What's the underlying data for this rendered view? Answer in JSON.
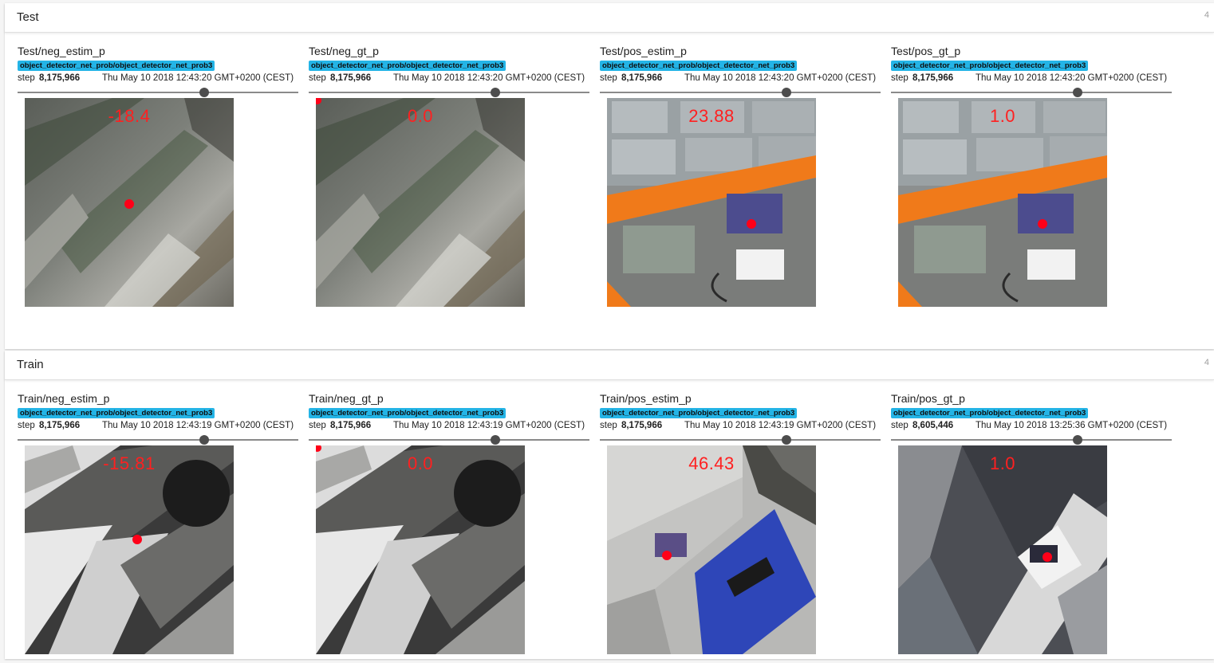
{
  "sections": [
    {
      "title": "Test",
      "count": "4",
      "cards": [
        {
          "title": "Test/neg_estim_p",
          "tag": "object_detector_net_prob/object_detector_net_prob3",
          "step_label": "step",
          "step": "8,175,966",
          "time": "Thu May 10 2018 12:43:20 GMT+0200 (CEST)",
          "value_text": "-18.4"
        },
        {
          "title": "Test/neg_gt_p",
          "tag": "object_detector_net_prob/object_detector_net_prob3",
          "step_label": "step",
          "step": "8,175,966",
          "time": "Thu May 10 2018 12:43:20 GMT+0200 (CEST)",
          "value_text": "0.0"
        },
        {
          "title": "Test/pos_estim_p",
          "tag": "object_detector_net_prob/object_detector_net_prob3",
          "step_label": "step",
          "step": "8,175,966",
          "time": "Thu May 10 2018 12:43:20 GMT+0200 (CEST)",
          "value_text": "23.88"
        },
        {
          "title": "Test/pos_gt_p",
          "tag": "object_detector_net_prob/object_detector_net_prob3",
          "step_label": "step",
          "step": "8,175,966",
          "time": "Thu May 10 2018 12:43:20 GMT+0200 (CEST)",
          "value_text": "1.0"
        }
      ]
    },
    {
      "title": "Train",
      "count": "4",
      "cards": [
        {
          "title": "Train/neg_estim_p",
          "tag": "object_detector_net_prob/object_detector_net_prob3",
          "step_label": "step",
          "step": "8,175,966",
          "time": "Thu May 10 2018 12:43:19 GMT+0200 (CEST)",
          "value_text": "-15.81"
        },
        {
          "title": "Train/neg_gt_p",
          "tag": "object_detector_net_prob/object_detector_net_prob3",
          "step_label": "step",
          "step": "8,175,966",
          "time": "Thu May 10 2018 12:43:19 GMT+0200 (CEST)",
          "value_text": "0.0"
        },
        {
          "title": "Train/pos_estim_p",
          "tag": "object_detector_net_prob/object_detector_net_prob3",
          "step_label": "step",
          "step": "8,175,966",
          "time": "Thu May 10 2018 12:43:19 GMT+0200 (CEST)",
          "value_text": "46.43"
        },
        {
          "title": "Train/pos_gt_p",
          "tag": "object_detector_net_prob/object_detector_net_prob3",
          "step_label": "step",
          "step": "8,605,446",
          "time": "Thu May 10 2018 13:25:36 GMT+0200 (CEST)",
          "value_text": "1.0"
        }
      ]
    }
  ],
  "colors": {
    "run_tag": "#24b4e6",
    "marker": "#ff0018",
    "value_text": "#ff2020"
  }
}
